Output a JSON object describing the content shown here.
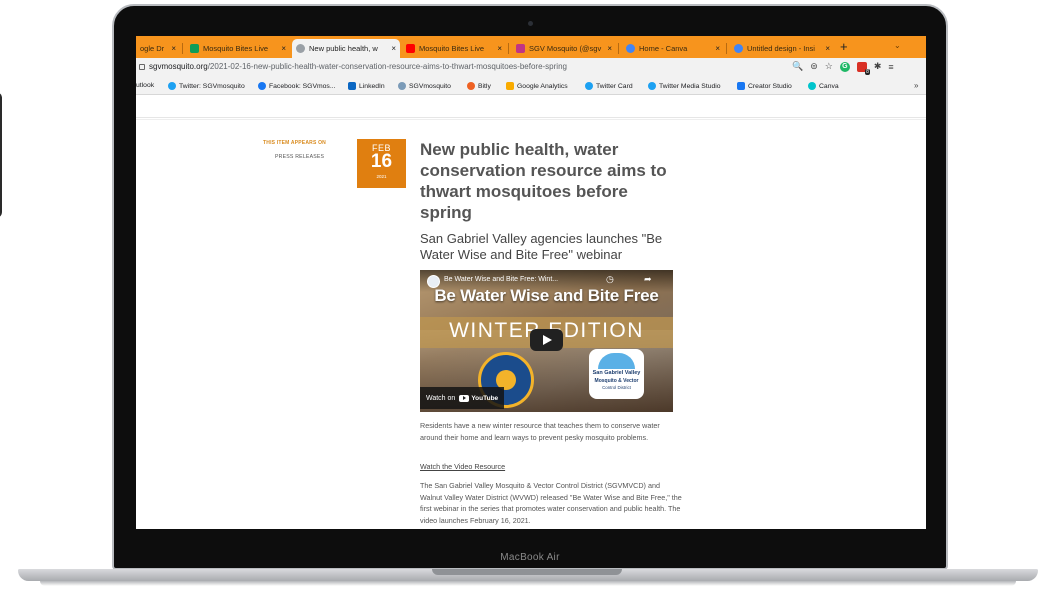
{
  "device": {
    "label": "MacBook Air"
  },
  "browser": {
    "tabs": [
      {
        "label": "ogle Dr",
        "favicon_color": "#34a853"
      },
      {
        "label": "Mosquito Bites Live",
        "favicon_color": "#0f9d58"
      },
      {
        "label": "New public health, w",
        "favicon_color": "#5f6368",
        "active": true
      },
      {
        "label": "Mosquito Bites Live",
        "favicon_color": "#ff0000"
      },
      {
        "label": "SGV Mosquito (@sgv",
        "favicon_color": "#c13584"
      },
      {
        "label": "Home - Canva",
        "favicon_color": "#4285f4"
      },
      {
        "label": "Untitled design - Insi",
        "favicon_color": "#4285f4"
      }
    ],
    "tab_close_glyph": "×",
    "new_tab_glyph": "+",
    "tab_menu_glyph": "⌄",
    "url_domain": "sgvmosquito.org",
    "url_path": "/2021-02-16-new-public-health-water-conservation-resource-aims-to-thwart-mosquitoes-before-spring",
    "toolbar_icons": {
      "zoom": "🔍",
      "share": "⊜",
      "star": "☆",
      "grammarly": "G",
      "puzzle": "✱",
      "menu": "≡"
    },
    "bookmarks": [
      {
        "label": "utlook",
        "icon_color": "#0078d4"
      },
      {
        "label": "Twitter: SGVmosquito",
        "icon_color": "#1da1f2"
      },
      {
        "label": "Facebook: SGVmos...",
        "icon_color": "#1877f2"
      },
      {
        "label": "LinkedIn",
        "icon_color": "#0a66c2"
      },
      {
        "label": "SGVmosquito",
        "icon_color": "#7b9bb8"
      },
      {
        "label": "Bitly",
        "icon_color": "#ee6123"
      },
      {
        "label": "Google Analytics",
        "icon_color": "#f9ab00"
      },
      {
        "label": "Twitter Card",
        "icon_color": "#1da1f2"
      },
      {
        "label": "Twitter Media Studio",
        "icon_color": "#1da1f2"
      },
      {
        "label": "Creator Studio",
        "icon_color": "#1877f2"
      },
      {
        "label": "Canva",
        "icon_color": "#00c4cc"
      }
    ],
    "bookmarks_more": "»"
  },
  "article": {
    "appears_label": "THIS ITEM APPEARS ON",
    "appears_link": "PRESS RELEASES",
    "date": {
      "month": "FEB",
      "day": "16",
      "year": "2021"
    },
    "headline": "New public health, water conservation resource aims to thwart mosquitoes before spring",
    "subhead": "San Gabriel Valley agencies launches \"Be Water Wise and Bite Free\" webinar",
    "video": {
      "small_title": "Be Water Wise and Bite Free: Wint...",
      "headline": "Be Water Wise and Bite Free",
      "edition": "WINTER EDITION",
      "clock_glyph": "◷",
      "share_glyph": "➦",
      "seal_right_line1": "San Gabriel Valley",
      "seal_right_line2": "Mosquito & Vector",
      "seal_right_line3": "Control District",
      "watch_on": "Watch on",
      "youtube": "YouTube"
    },
    "intro": "Residents have a new winter resource that teaches them to conserve water around their home and learn ways to prevent pesky mosquito problems.",
    "watch_link": "Watch the Video Resource",
    "body": "The San Gabriel Valley Mosquito & Vector Control District (SGVMVCD) and Walnut Valley Water District (WVWD) released \"Be Water Wise and Bite Free,\" the first webinar in the series that promotes water conservation and public health. The video launches February 16, 2021."
  }
}
